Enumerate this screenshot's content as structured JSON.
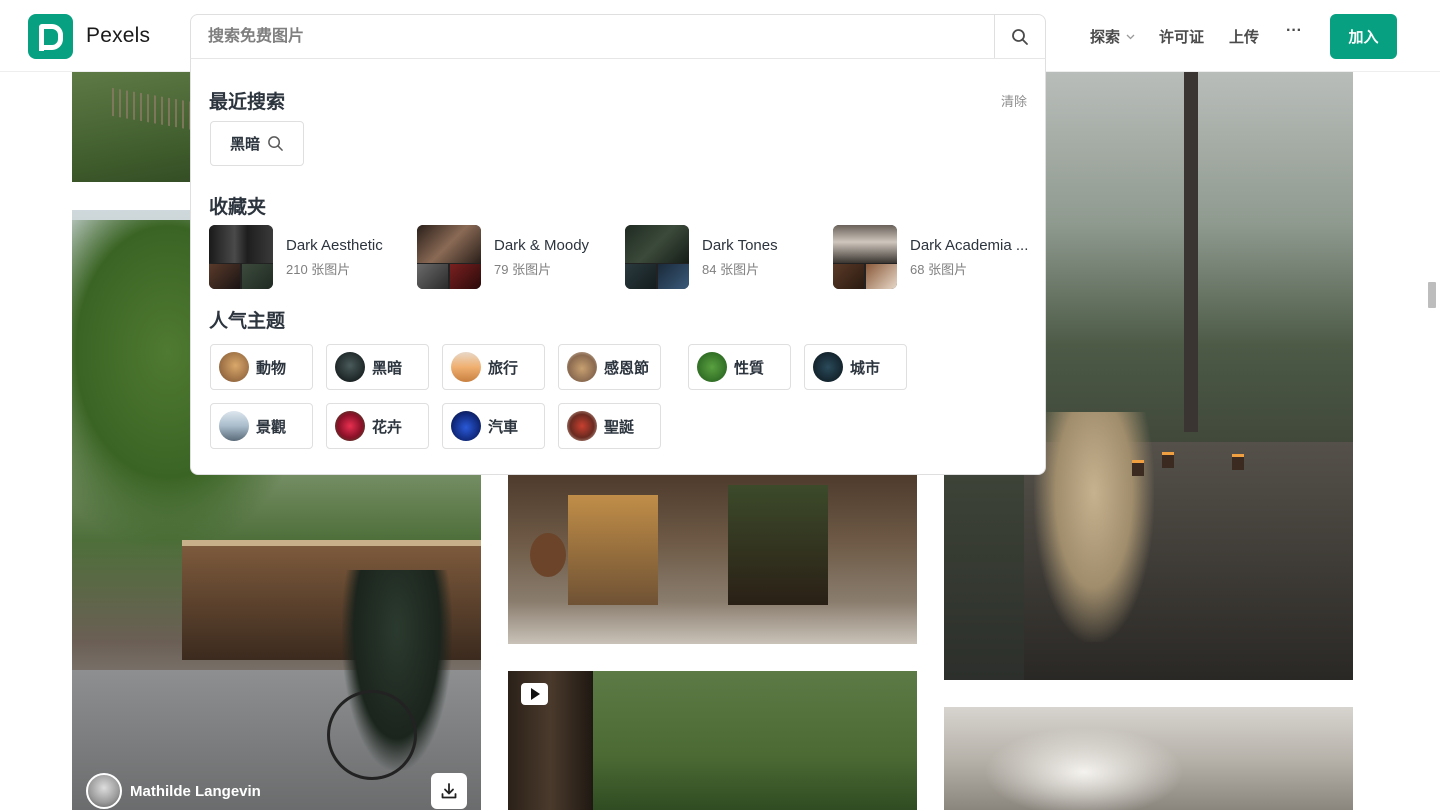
{
  "brand": {
    "name": "Pexels",
    "color": "#07a081"
  },
  "search": {
    "placeholder": "搜索免费图片"
  },
  "nav": {
    "explore": "探索",
    "license": "许可证",
    "upload": "上传",
    "more": "···",
    "join": "加入"
  },
  "dropdown": {
    "recent_title": "最近搜索",
    "clear_label": "清除",
    "recent_items": [
      "黑暗"
    ],
    "collections_title": "收藏夹",
    "collections": [
      {
        "title": "Dark Aesthetic",
        "count": "210 张图片"
      },
      {
        "title": "Dark & Moody",
        "count": "79 张图片"
      },
      {
        "title": "Dark Tones",
        "count": "84 张图片"
      },
      {
        "title": "Dark Academia ...",
        "count": "68 张图片"
      }
    ],
    "topics_title": "人气主题",
    "topics": [
      "動物",
      "黑暗",
      "旅行",
      "感恩節",
      "性質",
      "城市",
      "景觀",
      "花卉",
      "汽車",
      "聖誕"
    ]
  },
  "photo_card": {
    "photographer": "Mathilde Langevin"
  }
}
